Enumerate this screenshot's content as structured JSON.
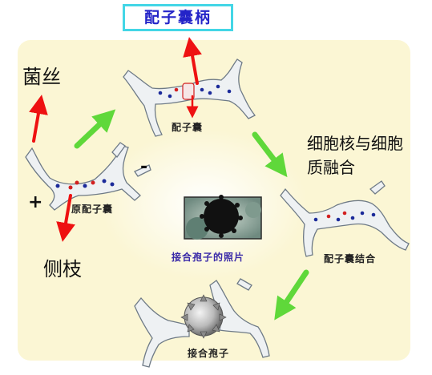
{
  "labels": {
    "suspensor": "配子囊柄",
    "hypha": "菌丝",
    "lateral_branch": "侧枝",
    "nuclear_fusion": "细胞核与细胞质融合",
    "progametangium": "原配子囊",
    "gametangium": "配子囊",
    "gametangia_fusion": "配子囊结合",
    "zygospore": "接合孢子",
    "photo_caption": "接合孢子的照片",
    "plus_sign": "+",
    "minus_sign": "-"
  },
  "colors": {
    "title_border": "#43d6e6",
    "title_text": "#2424c8",
    "panel_bg": "#fbf6d4",
    "red_arrow": "#ee1111",
    "green_arrow": "#5fd83a",
    "caption_text": "#3a2aa8"
  }
}
